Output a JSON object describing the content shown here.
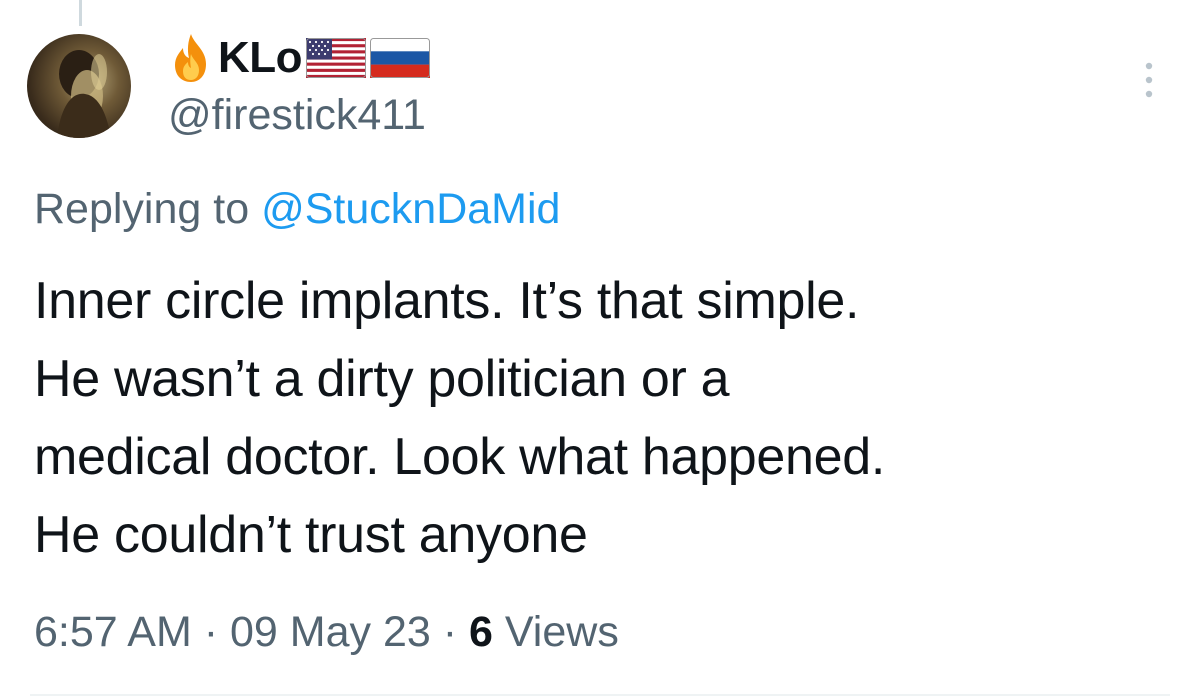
{
  "author": {
    "display_name": "KLo",
    "handle": "@firestick411",
    "name_emoji_icons": [
      "fire-icon",
      "us-flag-icon",
      "russia-flag-icon"
    ]
  },
  "reply": {
    "prefix": "Replying to",
    "target": "@StucknDaMid"
  },
  "tweet": {
    "lines": [
      "Inner circle implants. It’s that simple.",
      "He wasn’t a dirty politician or a",
      "medical doctor. Look what happened.",
      "He couldn’t trust anyone"
    ]
  },
  "meta": {
    "time": "6:57 AM",
    "separator": "·",
    "date": "09 May 23",
    "views_count": "6",
    "views_label": "Views"
  },
  "colors": {
    "text": "#0f1419",
    "secondary": "#536471",
    "link": "#1d9bf0",
    "divider": "#eff3f4"
  }
}
